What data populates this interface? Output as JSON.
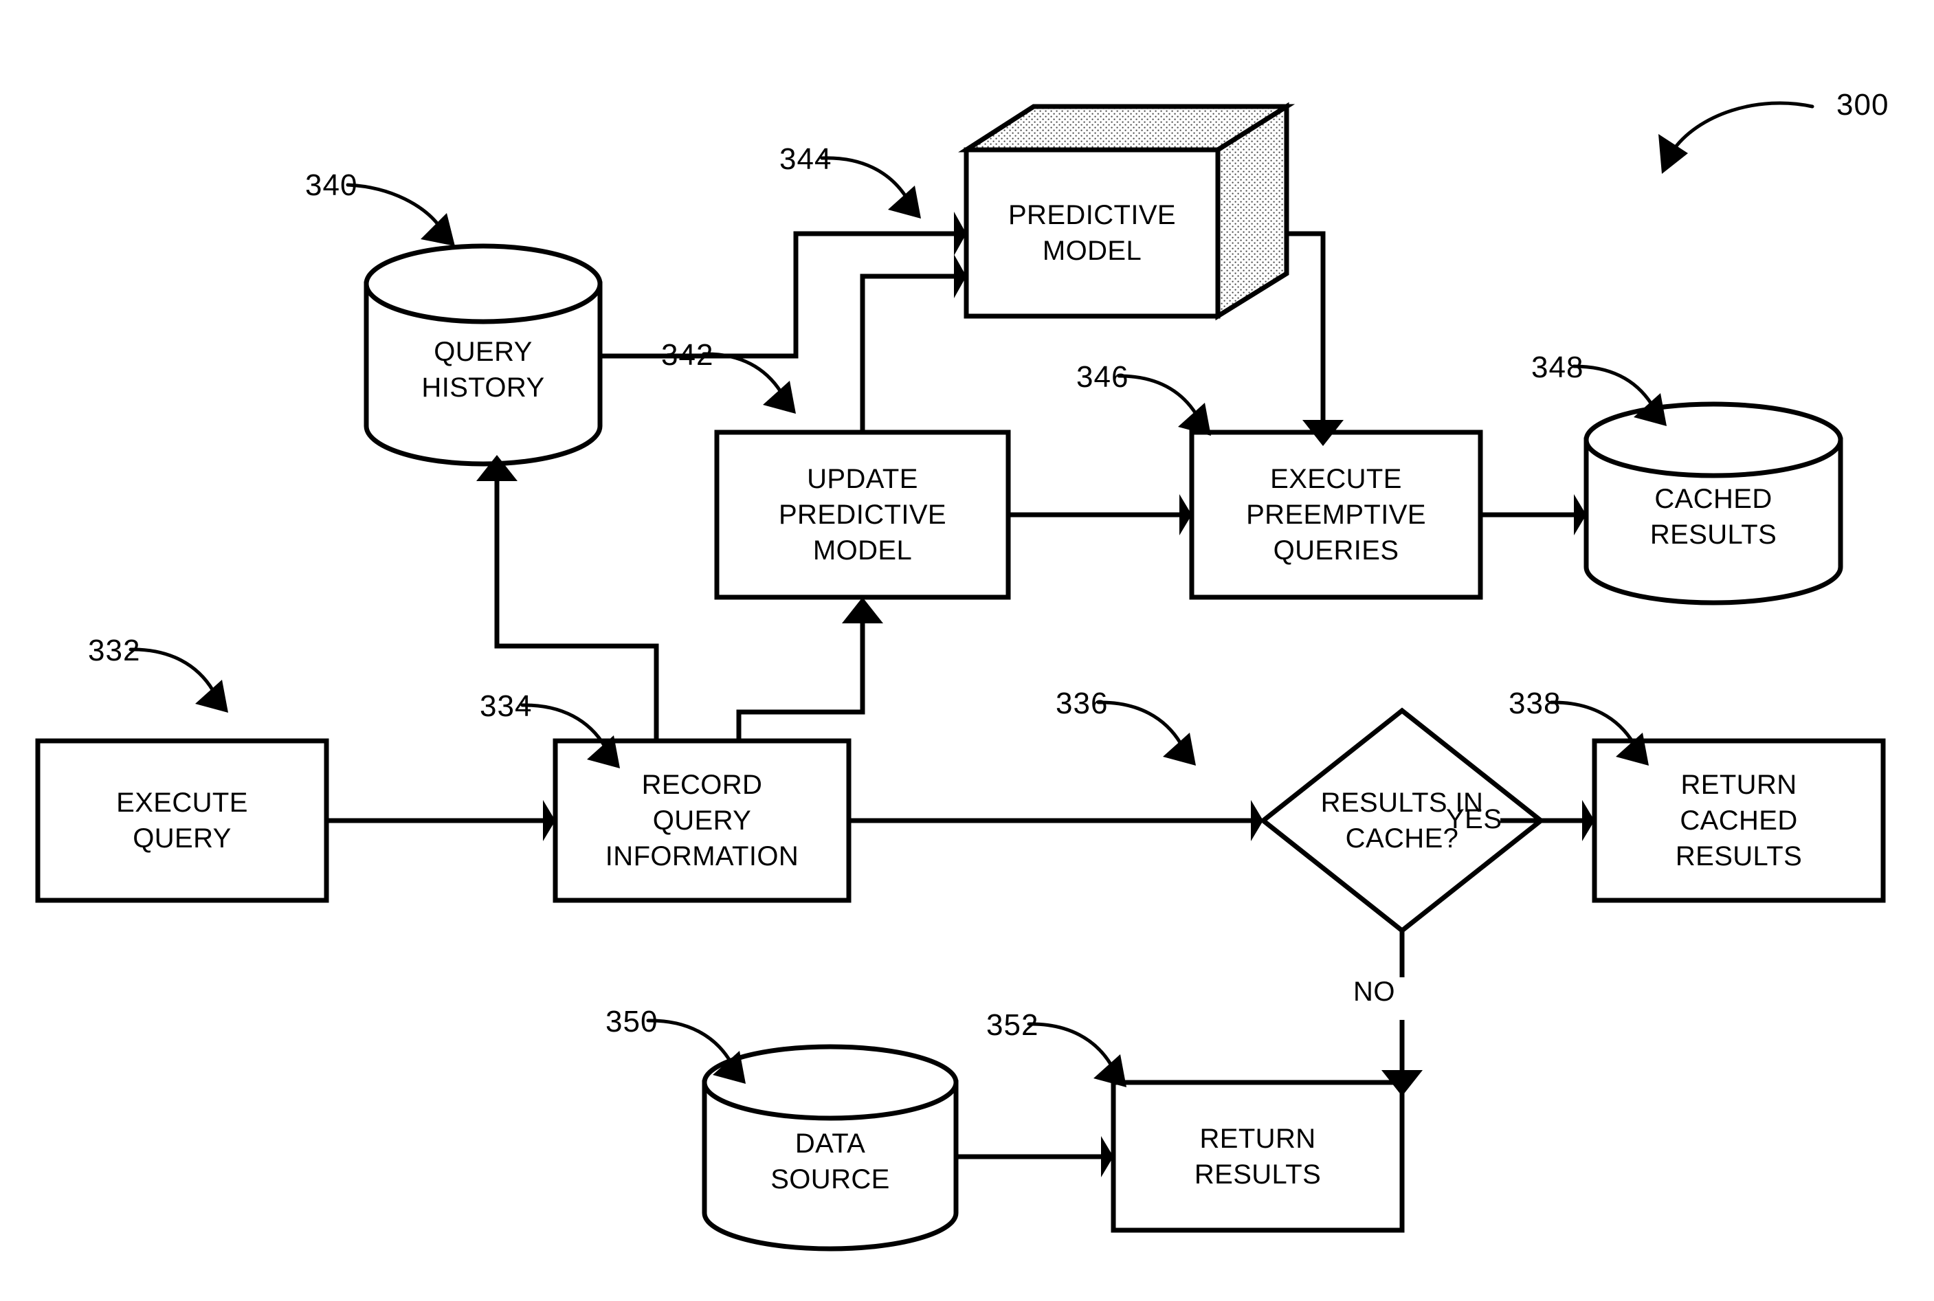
{
  "figure": {
    "figure_ref": "300",
    "nodes": [
      {
        "id": "execute_query",
        "label": "EXECUTE\nQUERY",
        "ref": "332",
        "shape": "rect"
      },
      {
        "id": "record_query_info",
        "label": "RECORD\nQUERY\nINFORMATION",
        "ref": "334",
        "shape": "rect"
      },
      {
        "id": "results_in_cache",
        "label": "RESULTS IN\nCACHE?",
        "ref": "336",
        "shape": "diamond"
      },
      {
        "id": "return_cached_results",
        "label": "RETURN\nCACHED\nRESULTS",
        "ref": "338",
        "shape": "rect"
      },
      {
        "id": "query_history",
        "label": "QUERY\nHISTORY",
        "ref": "340",
        "shape": "cylinder"
      },
      {
        "id": "update_predictive_model",
        "label": "UPDATE\nPREDICTIVE\nMODEL",
        "ref": "342",
        "shape": "rect"
      },
      {
        "id": "predictive_model",
        "label": "PREDICTIVE\nMODEL",
        "ref": "344",
        "shape": "cube3d"
      },
      {
        "id": "execute_preemptive_queries",
        "label": "EXECUTE\nPREEMPTIVE\nQUERIES",
        "ref": "346",
        "shape": "rect"
      },
      {
        "id": "cached_results",
        "label": "CACHED\nRESULTS",
        "ref": "348",
        "shape": "cylinder"
      },
      {
        "id": "data_source",
        "label": "DATA\nSOURCE",
        "ref": "350",
        "shape": "cylinder"
      },
      {
        "id": "return_results",
        "label": "RETURN\nRESULTS",
        "ref": "352",
        "shape": "rect"
      }
    ],
    "edge_labels": [
      {
        "id": "yes",
        "text": "YES"
      },
      {
        "id": "no",
        "text": "NO"
      }
    ],
    "edges": [
      {
        "from": "execute_query",
        "to": "record_query_info"
      },
      {
        "from": "record_query_info",
        "to": "results_in_cache"
      },
      {
        "from": "record_query_info",
        "to": "query_history"
      },
      {
        "from": "record_query_info",
        "to": "update_predictive_model"
      },
      {
        "from": "query_history",
        "to": "predictive_model"
      },
      {
        "from": "update_predictive_model",
        "to": "predictive_model"
      },
      {
        "from": "update_predictive_model",
        "to": "execute_preemptive_queries"
      },
      {
        "from": "predictive_model",
        "to": "execute_preemptive_queries"
      },
      {
        "from": "execute_preemptive_queries",
        "to": "cached_results"
      },
      {
        "from": "results_in_cache",
        "to": "return_cached_results",
        "label": "YES"
      },
      {
        "from": "results_in_cache",
        "to": "return_results",
        "label": "NO"
      },
      {
        "from": "data_source",
        "to": "return_results"
      }
    ],
    "colors": {
      "stroke": "#000000",
      "background": "#ffffff",
      "shade_fill": "#e8e8e8"
    }
  }
}
